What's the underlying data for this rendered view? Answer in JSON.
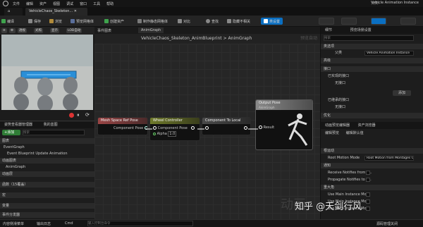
{
  "menubar": {
    "items": [
      "文件",
      "编辑",
      "资产",
      "视图",
      "调试",
      "窗口",
      "工具",
      "帮助"
    ],
    "parent_label": "父类:",
    "parent_value": "Vehicle Animation Instance"
  },
  "tabs": [
    "VehicleChaos_Skeleton...",
    "AnimGraph"
  ],
  "toolbar": {
    "compile": "编译",
    "save": "保存",
    "browse": "浏览",
    "preview_mesh": "预览网格体",
    "create_asset": "创建资产",
    "make_static_mesh": "制作静态网格体",
    "diff": "对比",
    "find": "查找",
    "hide_unrelated": "隐藏不相关",
    "class_settings": "类设置",
    "class_defaults": "类默认值"
  },
  "viewport": {
    "chips": [
      "透视",
      "光照",
      "显示",
      "LOD自动"
    ]
  },
  "left": {
    "tab_outline": "我的蓝图",
    "tab_asset": "姿势查看器管理器",
    "add": "+添加",
    "search_placeholder": "搜索",
    "sections": [
      {
        "label": "图表"
      },
      {
        "label": "EventGraph"
      },
      {
        "label": "Event Blueprint Update Animation"
      },
      {
        "label": "动画图表"
      },
      {
        "label": "AnimGraph"
      },
      {
        "label": "动画层"
      },
      {
        "label": "函数（15覆盖）"
      },
      {
        "label": "宏"
      },
      {
        "label": "变量"
      },
      {
        "label": "事件分发器"
      }
    ]
  },
  "graph": {
    "tab": "事件图表",
    "breadcrumb": [
      "VehicleChaos_Skeleton_AnimBlueprint",
      "AnimGraph"
    ],
    "watermark": "动画",
    "watermark_right": "预览自动",
    "nodes": {
      "mesh_space": {
        "title": "Mesh Space Ref Pose",
        "pin": "Component Pose"
      },
      "wheel_controller": {
        "title": "Wheel Controller",
        "pin_in": "Component Pose",
        "pin_out": "",
        "alpha_label": "Alpha",
        "alpha_value": "1.0"
      },
      "to_local": {
        "title": "Component To Local",
        "pin": ""
      },
      "output": {
        "title": "Output Pose",
        "subtitle": "AnimGraph",
        "pin": "Result"
      }
    }
  },
  "right": {
    "tab_details": "细节",
    "tab_preview": "预览场景设置",
    "search_placeholder": "搜索",
    "sections": [
      {
        "label": "类选项"
      },
      {
        "label": "父类",
        "value": "Vehicle Animation Instance"
      },
      {
        "label": "高级"
      },
      {
        "label": "接口"
      },
      {
        "label": "已实现的接口"
      },
      {
        "label": "无接口"
      },
      {
        "label": "已继承的接口"
      },
      {
        "label": "无接口"
      },
      {
        "label": "优化"
      }
    ],
    "add_label": "添加",
    "editor_tab": "动画预览编辑器",
    "asset_browser": "资产浏览器",
    "edit_preview": "编辑预览",
    "edit_defaults": "编辑默认值",
    "settings": [
      {
        "label": "根运动"
      },
      {
        "label": "Root Motion Mode",
        "value": "Root Motion from Montages Only"
      },
      {
        "label": "通知"
      },
      {
        "label": "Receive Notifies from L..."
      },
      {
        "label": "Propagate Notifies to L..."
      },
      {
        "label": "重大角"
      },
      {
        "label": "Use Main Instance Mo..."
      },
      {
        "label": "Use Main Instance Mo..."
      },
      {
        "label": "Use Main Instance Mo..."
      }
    ]
  },
  "statusbar": {
    "content_drawer": "内容侧滑菜单",
    "output_log": "输出日志",
    "cmd": "Cmd",
    "console_placeholder": "输入控制台命令",
    "watermark": "知乎 @天剑行风",
    "source_control": "源码管理关闭"
  }
}
